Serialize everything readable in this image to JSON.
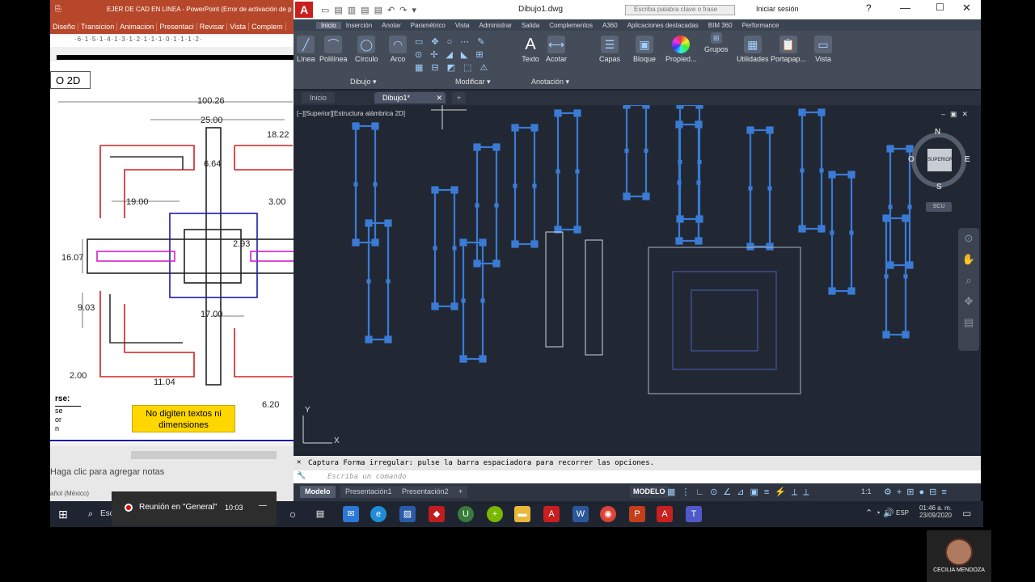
{
  "ppt": {
    "title": "EJER DE CAD EN LINEA - PowerPoint (Error de activación de p",
    "tabs": [
      "Diseño",
      "Transicion",
      "Animacion",
      "Presentaci",
      "Revisar",
      "Vista",
      "Complem"
    ],
    "ruler": "·6·1·5·1·4·1·3·1·2·1·1·1·0·1·1·1·2·",
    "slide_heading": "O 2D",
    "dims": [
      "100.26",
      "25.00",
      "18.22",
      "6.64",
      "19.00",
      "3.00",
      "16.07",
      "2.93",
      "9.03",
      "17.00",
      "2.00",
      "11.04",
      "6.20"
    ],
    "legend_label": "rse:",
    "legend_rows": [
      "se",
      "or",
      "n"
    ],
    "note_text": "No digiten textos ni dimensiones",
    "notes_placeholder": "Haga clic para agregar notas",
    "lang": "añol (México)"
  },
  "acad": {
    "file": "Dibujo1.dwg",
    "search_placeholder": "Escriba palabra clave o frase",
    "signin": "Iniciar sesión",
    "ribbon_tabs": [
      "Inicio",
      "Inserción",
      "Anotar",
      "Paramétrico",
      "Vista",
      "Administrar",
      "Salida",
      "Complementos",
      "A360",
      "Aplicaciones destacadas",
      "BIM 360",
      "Performance"
    ],
    "tools": [
      "Línea",
      "Polilínea",
      "Círculo",
      "Arco",
      "Texto",
      "Acotar",
      "Capas",
      "Bloque",
      "Propied...",
      "Grupos",
      "Utilidades",
      "Portapap...",
      "Vista"
    ],
    "panels": [
      "Dibujo ▾",
      "Modificar ▾",
      "Anotación ▾"
    ],
    "doc_tabs": [
      "Inicio",
      "Dibujo1*"
    ],
    "viewport_label": "[−][Superior][Estructura alámbrica 2D]",
    "viewcube": {
      "n": "N",
      "s": "S",
      "e": "E",
      "o": "O",
      "face": "SUPERIOR",
      "ucs": "SCU"
    },
    "command_history": "Captura Forma irregular: pulse la barra espaciadora para recorrer las opciones.",
    "command_placeholder": "Escriba un comando",
    "layout_tabs": [
      "Modelo",
      "Presentación1",
      "Presentación2"
    ],
    "status_model": "MODELO",
    "scale": "1:1"
  },
  "taskbar": {
    "search": "Esc",
    "meeting": "Reunión en \"General\"",
    "meeting_time": "10:03",
    "lang": "ESP",
    "time": "01:46 a. m.",
    "date": "23/09/2020"
  },
  "webcam_name": "CECILIA MENDOZA",
  "colors": {
    "ppt_red": "#b7472a",
    "acad_bg": "#212834",
    "sel_blue": "#3a7bd5"
  }
}
